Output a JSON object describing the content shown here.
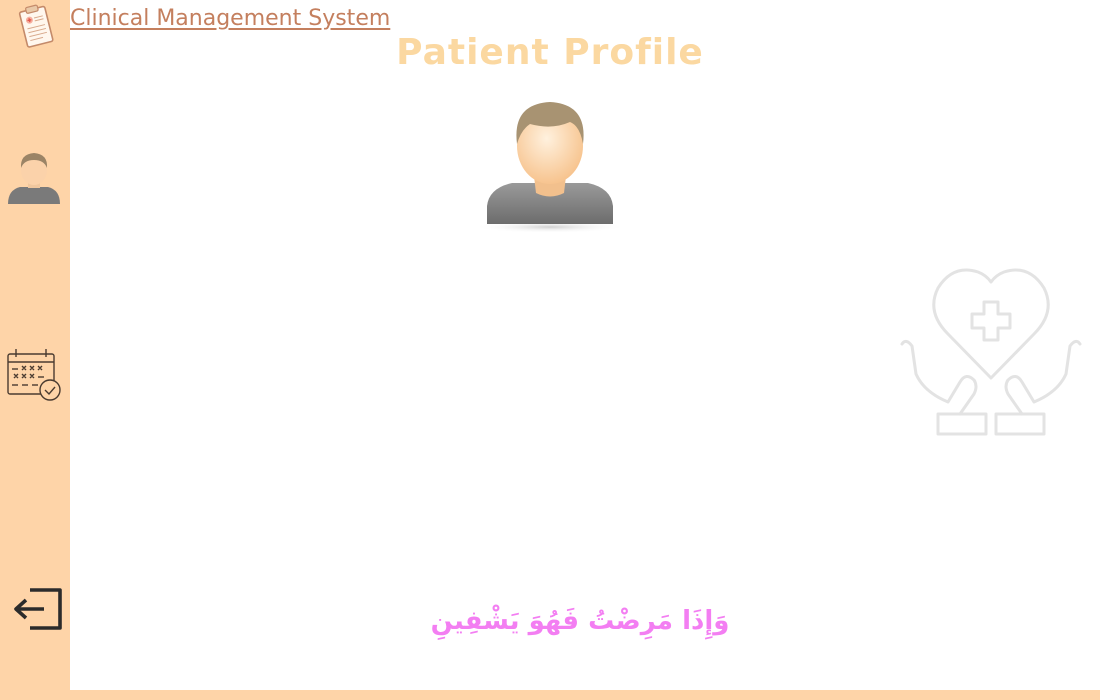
{
  "header": {
    "app_title": "Clinical Management System",
    "page_title": "Patient Profile"
  },
  "sidebar": {
    "items": [
      {
        "name": "profile",
        "icon": "user-avatar-icon"
      },
      {
        "name": "appointments",
        "icon": "calendar-check-icon"
      },
      {
        "name": "logout",
        "icon": "logout-icon"
      }
    ]
  },
  "main": {
    "avatar_icon": "user-avatar-icon",
    "decoration_icon": "hands-heart-cross-icon",
    "verse": "وَإِذَا مَرِضْتُ فَهُوَ يَشْفِينِ"
  },
  "colors": {
    "sidebar_bg": "#fed4a8",
    "title_link": "#c47f5e",
    "page_title": "#fbd8a1",
    "verse": "#f37ef2"
  }
}
